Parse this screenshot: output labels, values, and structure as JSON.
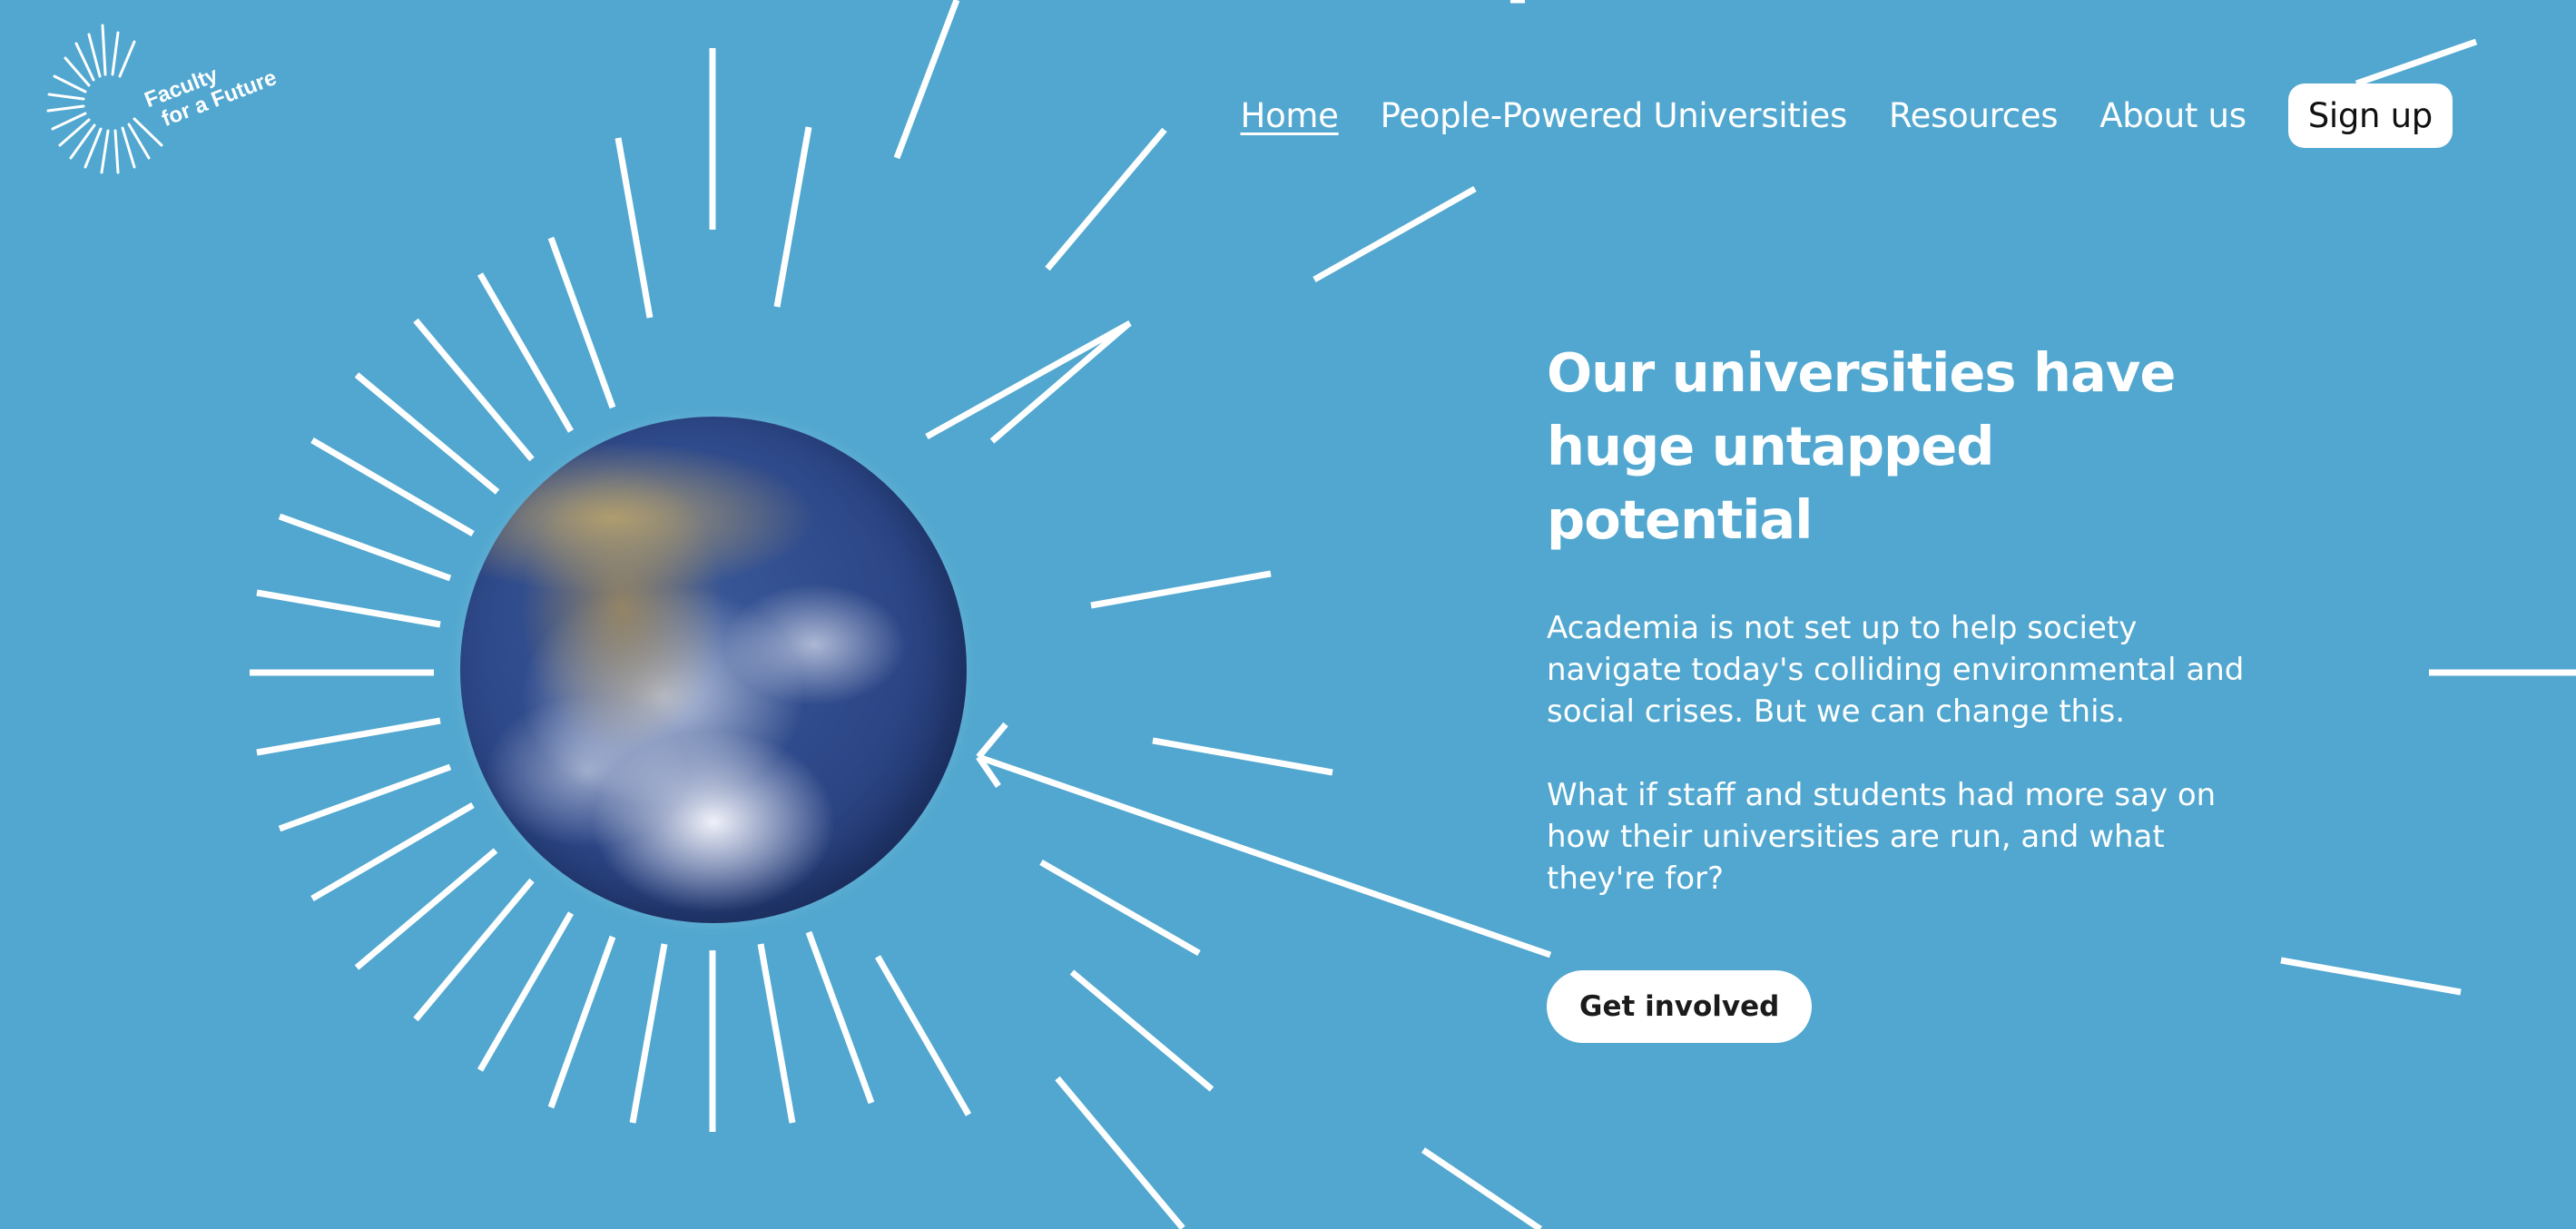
{
  "logo": {
    "line1": "Faculty",
    "line2": "for a Future",
    "icon": "sunburst-icon"
  },
  "nav": {
    "items": [
      {
        "label": "Home",
        "active": true
      },
      {
        "label": "People-Powered Universities",
        "active": false
      },
      {
        "label": "Resources",
        "active": false
      },
      {
        "label": "About us",
        "active": false
      }
    ],
    "signup_label": "Sign up"
  },
  "hero": {
    "heading": "Our universities have huge untapped potential",
    "paragraph1": "Academia is not set up to help society navigate today's colliding environmental and social crises. But we can change this.",
    "paragraph2": "What if staff and students had more say on how their universities are run, and what they're for?",
    "cta_label": "Get involved",
    "image": "earth-globe"
  },
  "colors": {
    "background": "#51a7cf",
    "foreground": "#ffffff",
    "button_bg": "#ffffff",
    "button_text": "#1b1b1b"
  }
}
